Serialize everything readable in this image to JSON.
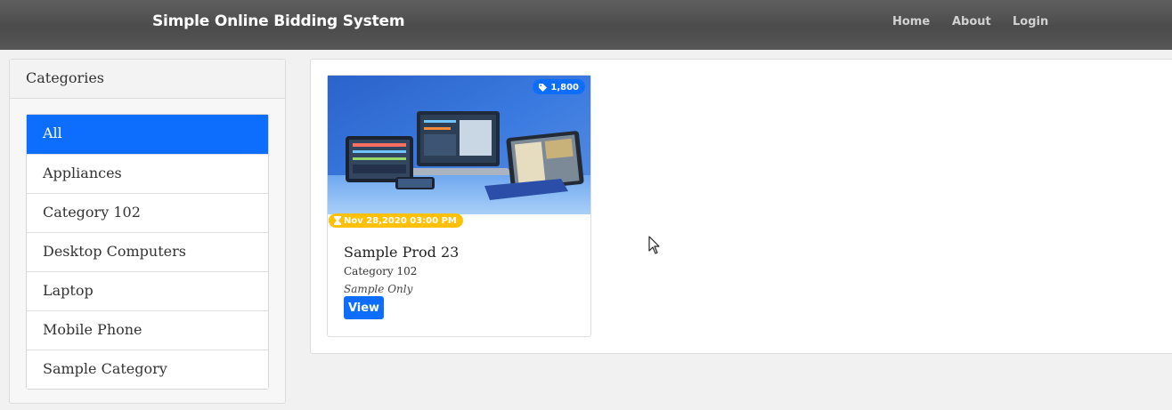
{
  "navbar": {
    "brand": "Simple Online Bidding System",
    "links": [
      "Home",
      "About",
      "Login"
    ]
  },
  "sidebar": {
    "title": "Categories",
    "items": [
      "All",
      "Appliances",
      "Category 102",
      "Desktop Computers",
      "Laptop",
      "Mobile Phone",
      "Sample Category"
    ],
    "active": "All"
  },
  "products": [
    {
      "name": "Sample Prod 23",
      "category": "Category 102",
      "description": "Sample Only",
      "price": "1,800",
      "date": "Nov 28,2020 03:00 PM",
      "view_label": "View",
      "image_icon": "tablets-devices-photo"
    }
  ],
  "colors": {
    "primary": "#0d6efd",
    "warning": "#ffc107",
    "navbar": "#555555"
  }
}
